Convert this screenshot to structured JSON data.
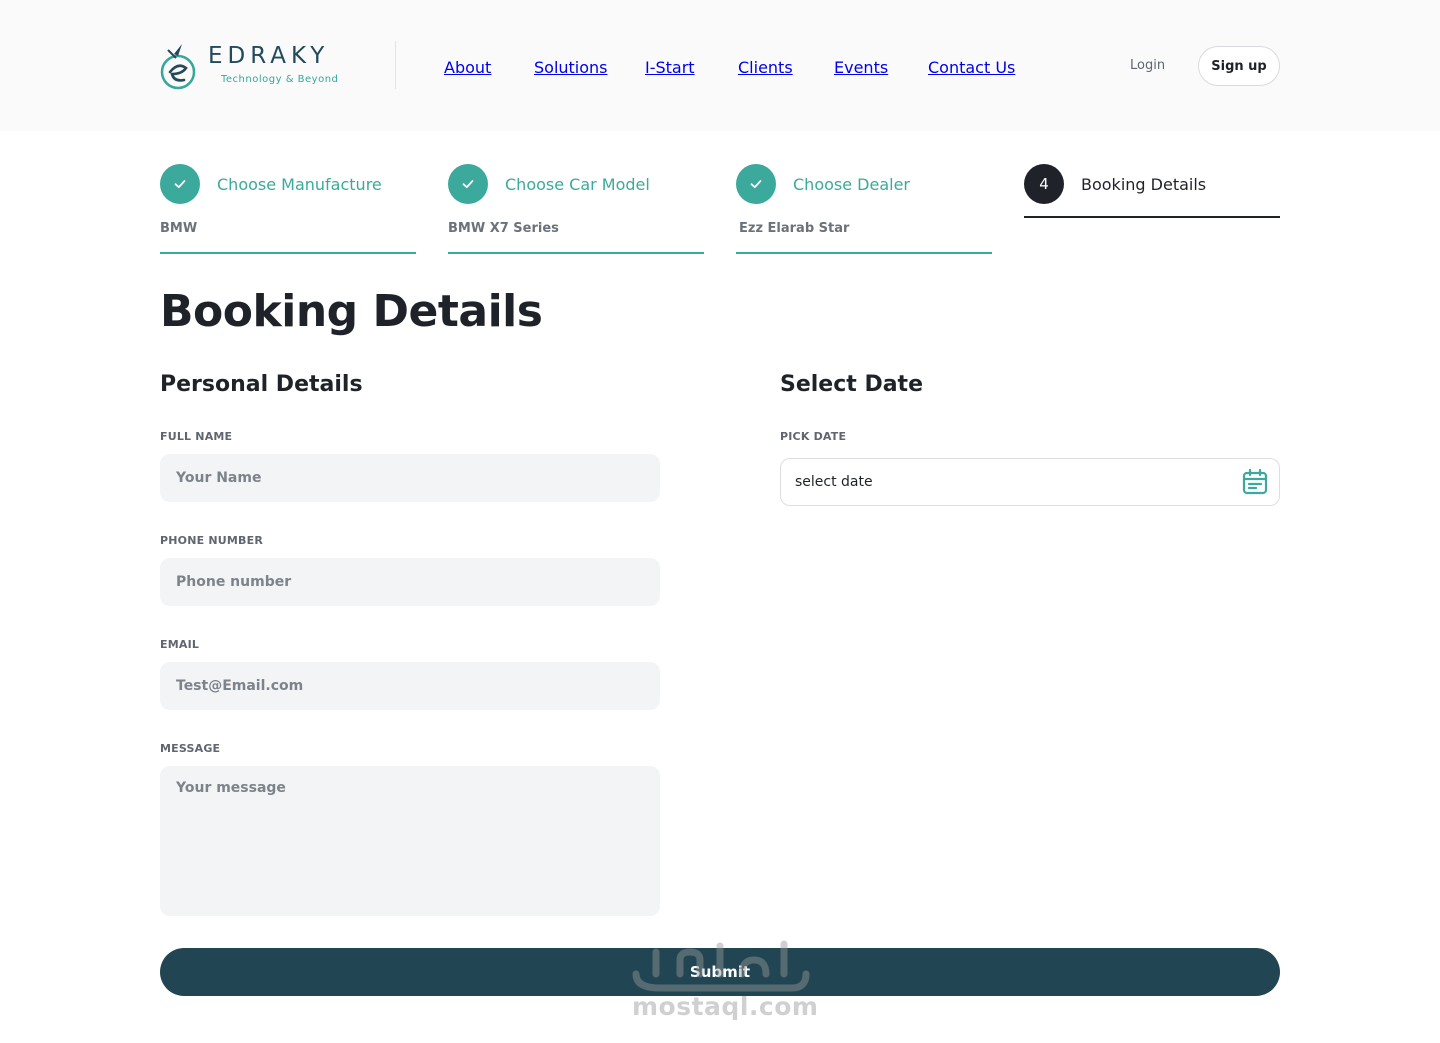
{
  "header": {
    "logo": {
      "name": "EDRAKY",
      "tagline": "Technology & Beyond"
    },
    "nav": [
      "About",
      "Solutions",
      "I-Start",
      "Clients",
      "Events",
      "Contact Us"
    ],
    "login_label": "Login",
    "signup_label": "Sign up"
  },
  "stepper": {
    "steps": [
      {
        "title": "Choose Manufacture",
        "value": "BMW",
        "status": "completed"
      },
      {
        "title": "Choose Car Model",
        "value": "BMW X7 Series",
        "status": "completed"
      },
      {
        "title": "Choose Dealer",
        "value": "Ezz Elarab Star",
        "status": "completed"
      },
      {
        "number": "4",
        "title": "Booking Details",
        "status": "current"
      }
    ]
  },
  "page_title": "Booking Details",
  "personal": {
    "title": "Personal Details",
    "full_name": {
      "label": "FULL NAME",
      "placeholder": "Your Name"
    },
    "phone": {
      "label": "PHONE NUMBER",
      "placeholder": "Phone number"
    },
    "email": {
      "label": "EMAIL",
      "placeholder": "Test@Email.com"
    },
    "message": {
      "label": "MESSAGE",
      "placeholder": "Your message"
    }
  },
  "date": {
    "title": "Select Date",
    "label": "PICK DATE",
    "placeholder": "select date",
    "icon": "calendar-icon"
  },
  "submit_label": "Submit",
  "watermark": {
    "text": "mostaql.com"
  },
  "colors": {
    "accent": "#3ba99c",
    "dark": "#1f2329",
    "button": "#224553",
    "field_bg": "#f3f4f6"
  }
}
